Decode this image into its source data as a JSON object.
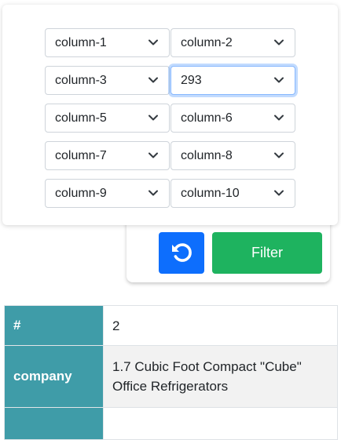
{
  "filters": {
    "selects": [
      {
        "value": "column-1"
      },
      {
        "value": "column-2"
      },
      {
        "value": "column-3"
      },
      {
        "value": "293"
      },
      {
        "value": "column-5"
      },
      {
        "value": "column-6"
      },
      {
        "value": "column-7"
      },
      {
        "value": "column-8"
      },
      {
        "value": "column-9"
      },
      {
        "value": "column-10"
      }
    ]
  },
  "actions": {
    "reset_icon": "reset-icon",
    "filter_label": "Filter"
  },
  "colors": {
    "reset_button": "#0d6efd",
    "filter_button": "#1eb35f",
    "table_header": "#3f9ca8"
  },
  "record": {
    "rows": [
      {
        "label": "#",
        "value": "2"
      },
      {
        "label": "company",
        "value": "1.7 Cubic Foot Compact \"Cube\" Office Refrigerators"
      },
      {
        "label": "",
        "value": ""
      }
    ]
  }
}
